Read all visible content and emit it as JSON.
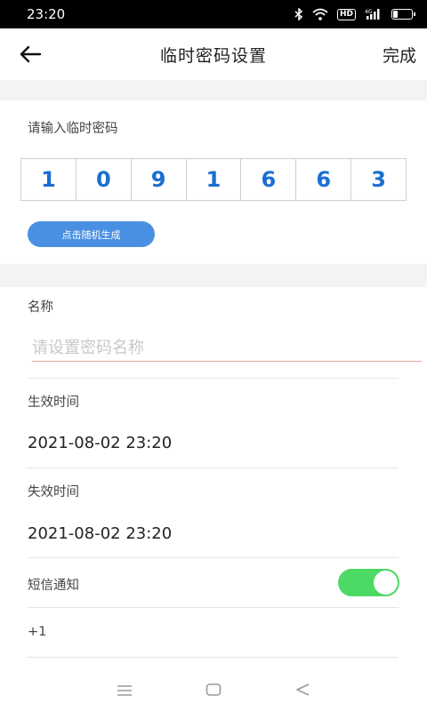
{
  "status_bar": {
    "time": "23:20",
    "icons": [
      "bluetooth-icon",
      "wifi-icon",
      "hd-icon",
      "signal-4g-icon",
      "battery-icon"
    ],
    "hd_label": "HD",
    "network_label": "4G",
    "battery_level": 0.25
  },
  "header": {
    "title": "临时密码设置",
    "done_label": "完成"
  },
  "password": {
    "prompt": "请输入临时密码",
    "digits": [
      "1",
      "0",
      "9",
      "1",
      "6",
      "6",
      "3"
    ],
    "random_button_label": "点击随机生成"
  },
  "name": {
    "label": "名称",
    "placeholder": "请设置密码名称",
    "value": ""
  },
  "effective_time": {
    "label": "生效时间",
    "value": "2021-08-02 23:20"
  },
  "expiry_time": {
    "label": "失效时间",
    "value": "2021-08-02 23:20"
  },
  "sms": {
    "label": "短信通知",
    "enabled": true
  },
  "country_code": "+1",
  "colors": {
    "accent": "#4a90e2",
    "digit": "#1a6fd0",
    "toggle_on": "#4cd964",
    "input_underline": "#e8a495"
  }
}
